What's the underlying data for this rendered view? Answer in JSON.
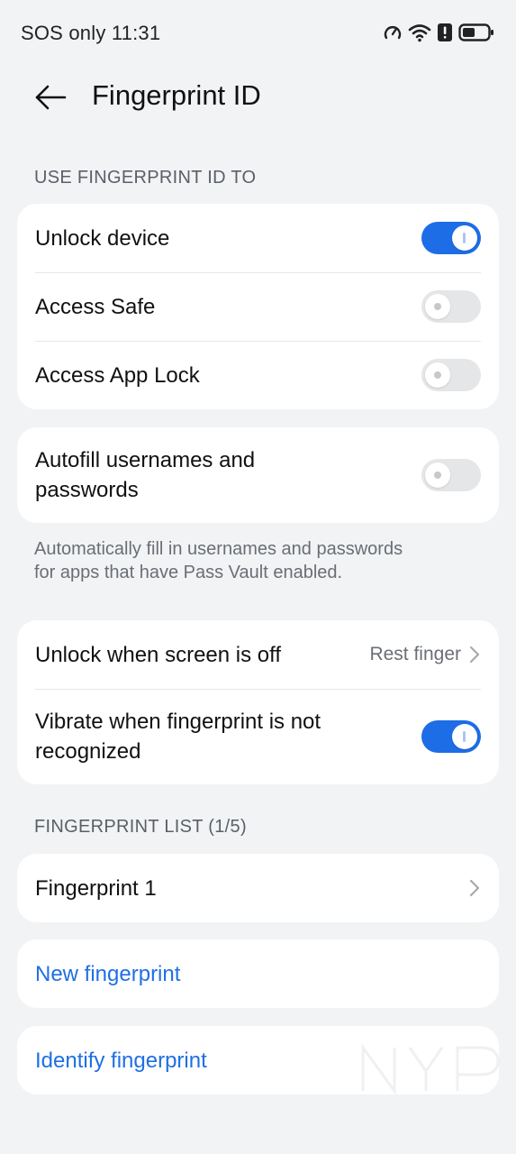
{
  "status_bar": {
    "carrier_time": "SOS only 11:31",
    "icons": [
      "speed-icon",
      "wifi-icon",
      "alert-icon",
      "battery-icon"
    ]
  },
  "header": {
    "title": "Fingerprint ID",
    "back_icon": "arrow-left-icon"
  },
  "use_section": {
    "header": "USE FINGERPRINT ID TO",
    "items": [
      {
        "label": "Unlock device",
        "enabled": true
      },
      {
        "label": "Access Safe",
        "enabled": false
      },
      {
        "label": "Access App Lock",
        "enabled": false
      }
    ]
  },
  "autofill": {
    "label_line1": "Autofill usernames and",
    "label_line2": "passwords",
    "enabled": false,
    "description_line1": "Automatically fill in usernames and passwords",
    "description_line2": "for apps that have Pass Vault enabled."
  },
  "screen_off": {
    "unlock_label": "Unlock when screen is off",
    "unlock_value": "Rest finger",
    "vibrate_line1": "Vibrate when fingerprint is not",
    "vibrate_line2": "recognized",
    "vibrate_enabled": true
  },
  "fingerprint_list": {
    "header": "FINGERPRINT LIST (1/5)",
    "items": [
      {
        "label": "Fingerprint 1"
      }
    ]
  },
  "actions": {
    "new_label": "New fingerprint",
    "identify_label": "Identify fingerprint"
  },
  "colors": {
    "accent": "#1d6de6",
    "link": "#1f6fe5",
    "background": "#f1f3f5",
    "card": "#ffffff"
  }
}
